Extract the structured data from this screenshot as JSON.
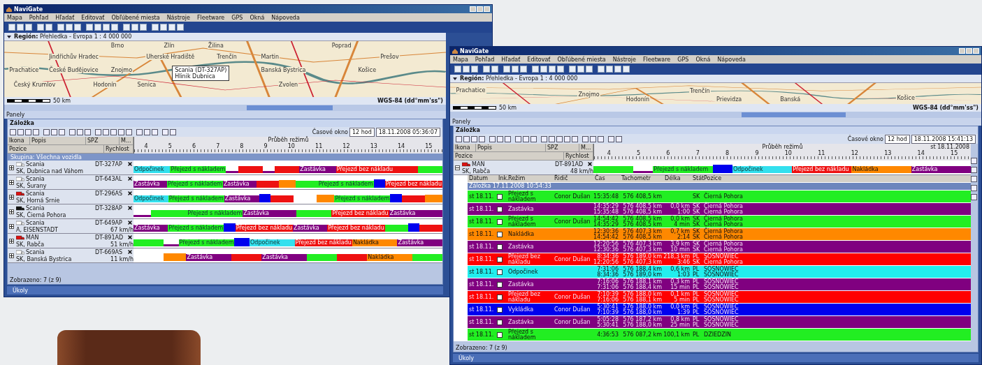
{
  "windows": [
    {
      "title": "NaviGate",
      "menu": [
        "Mapa",
        "Pohľad",
        "Hľadať",
        "Editovať",
        "Obľúbené miesta",
        "Nástroje",
        "Fleetware",
        "GPS",
        "Okná",
        "Nápoveda"
      ],
      "region": "**Región:** Přehledka - Evropa 1 : 4 000 000",
      "scale": "50 km",
      "projection": "WGS-84 (dd°mm'ss\")",
      "cities": [
        "Brno",
        "Zlín",
        "Žilina",
        "Poprad",
        "Jindřichův Hradec",
        "Uherské Hradiště",
        "Trenčín",
        "Martin",
        "Prešov",
        "Prachatice",
        "České Budějovice",
        "Znojmo",
        "Banská Bystrica",
        "Košice",
        "Český Krumlov",
        "Hodonín",
        "Senica",
        "Zvolen"
      ],
      "popup": [
        "Scania (DT-327AP)",
        "Hlinik Dubnica"
      ],
      "panels": "Panely",
      "tab": "Záložka",
      "time_window_label": "Časové okno",
      "time_window": "12 hod",
      "datetime": "18.11.2008 05:36:07",
      "columns": [
        "Ikona",
        "Popis",
        "SPZ",
        "M..."
      ],
      "subcolumns": [
        "Pozice",
        "Rychlost"
      ],
      "timeline_title": "Průběh režimů",
      "hours": [
        "4",
        "5",
        "6",
        "7",
        "8",
        "9",
        "10",
        "11",
        "12",
        "13",
        "14",
        "15"
      ],
      "group": "Skupina: Všechna vozidla",
      "vehicles": [
        {
          "name": "Scania",
          "plate": "DT-327AP",
          "location": "SK, Dubnica nad Váhom",
          "color": "#ffffff",
          "expanded": false,
          "segments": [
            {
              "kind": "rest",
              "label": "Odpočinek"
            },
            {
              "kind": "loaded",
              "label": "Přejezd s nákladem"
            },
            {
              "kind": "stop"
            },
            {
              "kind": "empty"
            },
            {
              "kind": "stop"
            },
            {
              "kind": "empty"
            },
            {
              "kind": "stop",
              "label": "Zastávka"
            },
            {
              "kind": "empty",
              "label": "Přejezd bez nákladu"
            },
            {
              "kind": "empty"
            },
            {
              "kind": "loaded"
            }
          ]
        },
        {
          "name": "Scania",
          "plate": "DT-643AL",
          "location": "SK, Šurany",
          "color": "#ffffff",
          "expanded": false,
          "segments": [
            {
              "kind": "stop",
              "label": "Zastávka"
            },
            {
              "kind": "loaded",
              "label": "Přejezd s nákladem"
            },
            {
              "kind": "stop",
              "label": "Zastávka"
            },
            {
              "kind": "empty"
            },
            {
              "kind": "loading"
            },
            {
              "kind": "loaded"
            },
            {
              "kind": "loaded",
              "label": "Přejezd s nákladem"
            },
            {
              "kind": "unloading"
            },
            {
              "kind": "empty",
              "label": "Přejezd bez nákladu"
            }
          ]
        },
        {
          "name": "Scania",
          "plate": "DT-296AS",
          "location": "SK, Horná Srnie",
          "color": "#dd1111",
          "expanded": false,
          "segments": [
            {
              "kind": "rest",
              "label": "Odpočinek"
            },
            {
              "kind": "loaded",
              "label": "Přejezd s nákladem"
            },
            {
              "kind": "stop",
              "label": "Zastávka"
            },
            {
              "kind": "unloading"
            },
            {
              "kind": "empty"
            },
            {
              "kind": "gap"
            },
            {
              "kind": "loading"
            },
            {
              "kind": "loaded",
              "label": "Přejezd s nákladem"
            },
            {
              "kind": "unloading"
            },
            {
              "kind": "empty"
            },
            {
              "kind": "loading"
            }
          ]
        },
        {
          "name": "Scania",
          "plate": "DT-328AP",
          "location": "SK, Čierná Pohora",
          "color": "#111111",
          "expanded": false,
          "segments": [
            {
              "kind": "stop"
            },
            {
              "kind": "loaded"
            },
            {
              "kind": "loaded",
              "label": "Přejezd s nákladem"
            },
            {
              "kind": "stop",
              "label": "Zastávka"
            },
            {
              "kind": "loaded"
            },
            {
              "kind": "empty",
              "label": "Přejezd bez nákladu"
            },
            {
              "kind": "stop",
              "label": "Zastávka"
            }
          ]
        },
        {
          "name": "Scania",
          "plate": "DT-649AP",
          "location": "A, EISENSTADT",
          "speed": "67 km/h",
          "color": "#ffffff",
          "expanded": false,
          "segments": [
            {
              "kind": "stop",
              "label": "Zastávka"
            },
            {
              "kind": "loaded",
              "label": "Přejezd s nákladem"
            },
            {
              "kind": "unloading"
            },
            {
              "kind": "empty",
              "label": "Přejezd bez nákladu"
            },
            {
              "kind": "stop",
              "label": "Zastávka"
            },
            {
              "kind": "empty",
              "label": "Přejezd bez nákladu"
            },
            {
              "kind": "loaded"
            },
            {
              "kind": "unloading"
            },
            {
              "kind": "empty"
            }
          ]
        },
        {
          "name": "MAN",
          "plate": "DT-891AD",
          "location": "SK, Rabča",
          "speed": "51 km/h",
          "color": "#dd1111",
          "expanded": false,
          "segments": [
            {
              "kind": "loaded"
            },
            {
              "kind": "stop"
            },
            {
              "kind": "loaded",
              "label": "Přejezd s nákladem"
            },
            {
              "kind": "unloading"
            },
            {
              "kind": "rest",
              "label": "Odpočinek"
            },
            {
              "kind": "empty",
              "label": "Přejezd bez nákladu"
            },
            {
              "kind": "loading",
              "label": "Nakládka"
            },
            {
              "kind": "stop",
              "label": "Zastávka"
            }
          ]
        },
        {
          "name": "Scania",
          "plate": "DT-669AS",
          "location": "SK, Banská Bystrica",
          "speed": "11 km/h",
          "color": "#ffffff",
          "expanded": false,
          "segments": [
            {
              "kind": "gap"
            },
            {
              "kind": "loading"
            },
            {
              "kind": "stop",
              "label": "Zastávka"
            },
            {
              "kind": "empty"
            },
            {
              "kind": "stop",
              "label": "Zastávka"
            },
            {
              "kind": "loaded"
            },
            {
              "kind": "empty"
            },
            {
              "kind": "loading",
              "label": "Nakládka"
            },
            {
              "kind": "loaded"
            }
          ]
        }
      ],
      "status": "Zobrazeno: 7 (z 9)",
      "bottom_tab": "Úkoly"
    },
    {
      "title": "NaviGate",
      "menu": [
        "Mapa",
        "Pohľad",
        "Hľadať",
        "Editovať",
        "Obľúbené miesta",
        "Nástroje",
        "Fleetware",
        "GPS",
        "Okná",
        "Nápoveda"
      ],
      "region": "**Región:** Přehledka - Evropa 1 : 4 000 000",
      "scale": "50 km",
      "projection": "WGS-84 (dd°mm'ss\")",
      "cities": [
        "Prachatice",
        "Znojmo",
        "Hodonín",
        "Trenčín",
        "Prievidza",
        "Banská",
        "Košice"
      ],
      "panels": "Panely",
      "tab": "Záložka",
      "time_window_label": "Časové okno",
      "time_window": "12 hod",
      "datetime": "18.11.2008 15:41:13",
      "columns": [
        "Ikona",
        "Popis",
        "SPZ",
        "M..."
      ],
      "subcolumns": [
        "Pozice",
        "Rychlost"
      ],
      "timeline_title": "Průběh režimů",
      "day_label": "st 18.11.2008",
      "hours": [
        "4",
        "5",
        "6",
        "7",
        "8",
        "9",
        "10",
        "11",
        "12",
        "13",
        "14",
        "15"
      ],
      "vehicles": [
        {
          "name": "MAN",
          "plate": "DT-891AD",
          "location": "SK, Rabča",
          "speed": "48 km/h",
          "color": "#dd1111",
          "expanded": true,
          "segments": [
            {
              "kind": "loaded"
            },
            {
              "kind": "stop"
            },
            {
              "kind": "loaded",
              "label": "Přejezd s nákladem"
            },
            {
              "kind": "unloading"
            },
            {
              "kind": "rest",
              "label": "Odpočinek"
            },
            {
              "kind": "empty",
              "label": "Přejezd bez nákladu"
            },
            {
              "kind": "loading",
              "label": "Nakládka"
            },
            {
              "kind": "stop",
              "label": "Zastávka"
            }
          ]
        }
      ],
      "detail": {
        "columns": [
          "Datum",
          "Ink.",
          "Režim",
          "Řidič",
          "Čas",
          "Tachometr",
          "Délka",
          "Stát",
          "Pozice"
        ],
        "group": "Záložka 17.11.2008 10:54:33",
        "rows": [
          {
            "color": "#22ee22",
            "date": "st 18.11.",
            "mode": "Přejezd s nákladem",
            "driver": "Conor Dušan",
            "lines": [
              {
                "time": "15:35:48",
                "odometer": "576 408,5 km",
                "country": "SK",
                "position": "Čierná Pohora"
              }
            ]
          },
          {
            "color": "#800080",
            "date": "st 18.11.",
            "mode": "Zastávka",
            "lines": [
              {
                "time": "14:35:29",
                "odometer": "576 408,5 km",
                "length": "0,0 km",
                "country": "SK",
                "position": "Čierná Pohora"
              },
              {
                "time": "15:35:48",
                "odometer": "576 408,5 km",
                "length": "1:00",
                "country": "SK",
                "position": "Čierná Pohora"
              }
            ]
          },
          {
            "color": "#22ee22",
            "date": "st 18.11.",
            "mode": "Přejezd s nákladem",
            "driver": "Conor Dušan",
            "lines": [
              {
                "time": "14:54:42",
                "odometer": "576 408,5 km",
                "length": "0,0 km",
                "country": "SK",
                "position": "Čierná Pohora"
              },
              {
                "time": "14:35:29",
                "odometer": "576 408,5 km",
                "length": "4 min",
                "country": "SK",
                "position": "Čierná Pohora"
              }
            ]
          },
          {
            "color": "#ff8800",
            "date": "st 18.11.",
            "mode": "Nakládka",
            "lines": [
              {
                "time": "12:30:36",
                "odometer": "576 407,3 km",
                "length": "0,7 km",
                "country": "SK",
                "position": "Čierná Pohora"
              },
              {
                "time": "14:54:42",
                "odometer": "576 408,5 km",
                "length": "2:14",
                "country": "SK",
                "position": "Čierná Pohora"
              }
            ]
          },
          {
            "color": "#800080",
            "date": "st 18.11.",
            "mode": "Zastávka",
            "lines": [
              {
                "time": "12:20:56",
                "odometer": "576 407,3 km",
                "length": "3,9 km",
                "country": "SK",
                "position": "Čierná Pohora"
              },
              {
                "time": "12:30:36",
                "odometer": "576 407,3 km",
                "length": "10 min",
                "country": "SK",
                "position": "Čierná Pohora"
              }
            ]
          },
          {
            "color": "#ff0000",
            "date": "st 18.11.",
            "mode": "Přejezd bez nákladu",
            "driver": "Conor Dušan",
            "lines": [
              {
                "time": "8:34:36",
                "odometer": "576 189,0 km",
                "length": "218,3 km",
                "country": "PL",
                "position": "SOSNOWIEC"
              },
              {
                "time": "12:20:56",
                "odometer": "576 407,3 km",
                "length": "3:46",
                "country": "SK",
                "position": "Čierná Pohora"
              }
            ]
          },
          {
            "color": "#22eeee",
            "date": "st 18.11.",
            "mode": "Odpočinek",
            "lines": [
              {
                "time": "7:31:06",
                "odometer": "576 188,4 km",
                "length": "0,6 km",
                "country": "PL",
                "position": "SOSNOWIEC"
              },
              {
                "time": "8:34:36",
                "odometer": "576 189,0 km",
                "length": "1:03",
                "country": "PL",
                "position": "SOSNOWIEC"
              }
            ]
          },
          {
            "color": "#800080",
            "date": "st 18.11.",
            "mode": "Zastávka",
            "lines": [
              {
                "time": "7:16:06",
                "odometer": "576 188,1 km",
                "length": "0,3 km",
                "country": "PL",
                "position": "SOSNOWIEC"
              },
              {
                "time": "7:31:06",
                "odometer": "576 188,4 km",
                "length": "15 min",
                "country": "PL",
                "position": "SOSNOWIEC"
              }
            ]
          },
          {
            "color": "#ff0000",
            "date": "st 18.11.",
            "mode": "Přejezd bez nákladu",
            "driver": "Conor Dušan",
            "lines": [
              {
                "time": "7:10:39",
                "odometer": "576 188,0 km",
                "length": "0,1 km",
                "country": "PL",
                "position": "SOSNOWIEC"
              },
              {
                "time": "7:16:06",
                "odometer": "576 188,1 km",
                "length": "5 min",
                "country": "PL",
                "position": "SOSNOWIEC"
              }
            ]
          },
          {
            "color": "#0000ee",
            "date": "st 18.11.",
            "mode": "Vykládka",
            "driver": "Conor Dušan",
            "lines": [
              {
                "time": "5:30:41",
                "odometer": "576 188,0 km",
                "length": "0,0 km",
                "country": "PL",
                "position": "SOSNOWIEC"
              },
              {
                "time": "7:10:39",
                "odometer": "576 188,0 km",
                "length": "1:39",
                "country": "PL",
                "position": "SOSNOWIEC"
              }
            ]
          },
          {
            "color": "#800080",
            "date": "st 18.11.",
            "mode": "Zastávka",
            "driver": "Conor Dušan",
            "lines": [
              {
                "time": "5:05:28",
                "odometer": "576 187,2 km",
                "length": "0,8 km",
                "country": "PL",
                "position": "SOSNOWIEC"
              },
              {
                "time": "5:30:41",
                "odometer": "576 188,0 km",
                "length": "25 min",
                "country": "PL",
                "position": "SOSNOWIEC"
              }
            ]
          },
          {
            "color": "#22ee22",
            "date": "st 18.11.",
            "mode": "Přejezd s nákladem",
            "lines": [
              {
                "time": "4:36:53",
                "odometer": "576 087,2 km",
                "length": "100,1 km",
                "country": "PL",
                "position": "DZIEDZIN"
              }
            ]
          }
        ]
      },
      "status": "Zobrazeno: 7 (z 9)",
      "bottom_tab": "Úkoly"
    }
  ]
}
